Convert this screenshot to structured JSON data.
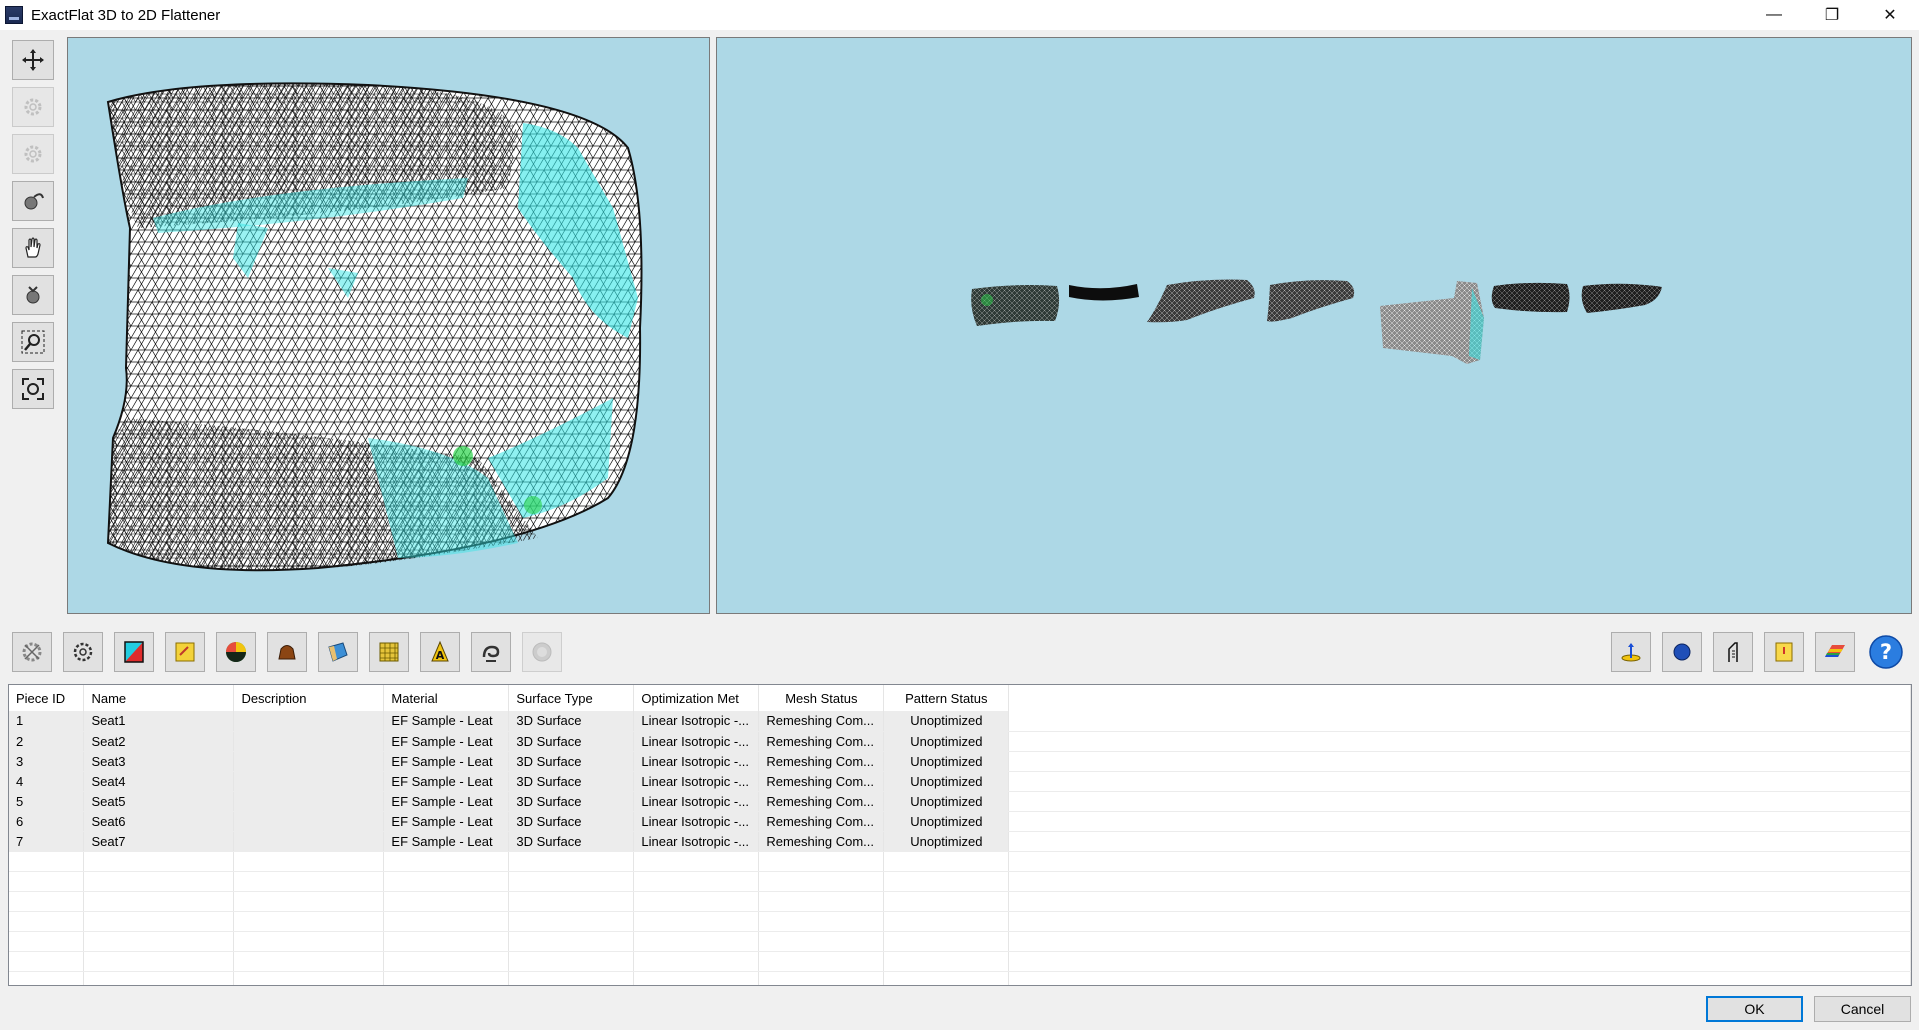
{
  "window": {
    "title": "ExactFlat 3D to 2D Flattener",
    "controls": {
      "minimize": "—",
      "restore": "❐",
      "close": "✕"
    }
  },
  "left_toolbar": [
    {
      "icon": "move-icon",
      "enabled": true
    },
    {
      "icon": "gear-icon",
      "enabled": false
    },
    {
      "icon": "gear-icon",
      "enabled": false
    },
    {
      "icon": "rotate-icon",
      "enabled": true
    },
    {
      "icon": "pan-hand-icon",
      "enabled": true
    },
    {
      "icon": "zoom-drag-icon",
      "enabled": true
    },
    {
      "icon": "zoom-window-icon",
      "enabled": true
    },
    {
      "icon": "zoom-extents-icon",
      "enabled": true
    }
  ],
  "bottom_toolbar_left": [
    {
      "icon": "flatten-icon",
      "enabled": true
    },
    {
      "icon": "mesh-settings-icon",
      "enabled": true
    },
    {
      "icon": "material-color-icon",
      "enabled": true
    },
    {
      "icon": "pattern-yellow-icon",
      "enabled": true
    },
    {
      "icon": "color-wheel-icon",
      "enabled": true
    },
    {
      "icon": "hide-piece-icon",
      "enabled": true
    },
    {
      "icon": "fabric-icon",
      "enabled": true
    },
    {
      "icon": "honeycomb-icon",
      "enabled": true
    },
    {
      "icon": "text-label-icon",
      "enabled": true
    },
    {
      "icon": "spiral-icon",
      "enabled": true
    },
    {
      "icon": "disabled-circle-icon",
      "enabled": false
    }
  ],
  "bottom_toolbar_right": [
    {
      "icon": "axis-icon"
    },
    {
      "icon": "sphere-icon"
    },
    {
      "icon": "ruler-icon"
    },
    {
      "icon": "notes-icon"
    },
    {
      "icon": "rainbow-icon"
    },
    {
      "icon": "help-icon"
    }
  ],
  "table": {
    "columns": [
      "Piece ID",
      "Name",
      "Description",
      "Material",
      "Surface Type",
      "Optimization Met",
      "Mesh Status",
      "Pattern Status"
    ],
    "rows": [
      {
        "id": "1",
        "name": "Seat1",
        "description": "",
        "material": "EF Sample - Leat",
        "surface": "3D Surface",
        "optimization": "Linear Isotropic -...",
        "mesh": "Remeshing Com...",
        "pattern": "Unoptimized"
      },
      {
        "id": "2",
        "name": "Seat2",
        "description": "",
        "material": "EF Sample - Leat",
        "surface": "3D Surface",
        "optimization": "Linear Isotropic -...",
        "mesh": "Remeshing Com...",
        "pattern": "Unoptimized"
      },
      {
        "id": "3",
        "name": "Seat3",
        "description": "",
        "material": "EF Sample - Leat",
        "surface": "3D Surface",
        "optimization": "Linear Isotropic -...",
        "mesh": "Remeshing Com...",
        "pattern": "Unoptimized"
      },
      {
        "id": "4",
        "name": "Seat4",
        "description": "",
        "material": "EF Sample - Leat",
        "surface": "3D Surface",
        "optimization": "Linear Isotropic -...",
        "mesh": "Remeshing Com...",
        "pattern": "Unoptimized"
      },
      {
        "id": "5",
        "name": "Seat5",
        "description": "",
        "material": "EF Sample - Leat",
        "surface": "3D Surface",
        "optimization": "Linear Isotropic -...",
        "mesh": "Remeshing Com...",
        "pattern": "Unoptimized"
      },
      {
        "id": "6",
        "name": "Seat6",
        "description": "",
        "material": "EF Sample - Leat",
        "surface": "3D Surface",
        "optimization": "Linear Isotropic -...",
        "mesh": "Remeshing Com...",
        "pattern": "Unoptimized"
      },
      {
        "id": "7",
        "name": "Seat7",
        "description": "",
        "material": "EF Sample - Leat",
        "surface": "3D Surface",
        "optimization": "Linear Isotropic -...",
        "mesh": "Remeshing Com...",
        "pattern": "Unoptimized"
      }
    ]
  },
  "buttons": {
    "ok": "OK",
    "cancel": "Cancel"
  },
  "colors": {
    "viewport_bg": "#add8e6",
    "stress_cyan": "#33e6e6",
    "accent": "#0078d7"
  }
}
